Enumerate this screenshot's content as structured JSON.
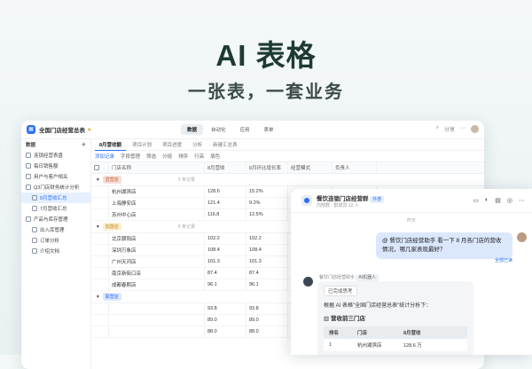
{
  "hero": {
    "title": "AI 表格",
    "subtitle": "一张表，一套业务"
  },
  "app": {
    "title": "全国门店经营总表",
    "modes": [
      "数据",
      "自动化",
      "应用",
      "表单"
    ],
    "share_label": "分享",
    "sidebar": {
      "header": "数据",
      "items": [
        {
          "label": "连锁经营表盘",
          "sub": false
        },
        {
          "label": "每日销售额",
          "sub": false
        },
        {
          "label": "用户与客户相关",
          "sub": false
        },
        {
          "label": "Q3门店财务统计分析",
          "sub": false
        },
        {
          "label": "8月营收汇总",
          "sub": true,
          "active": true
        },
        {
          "label": "7月营收汇总",
          "sub": true
        },
        {
          "label": "产品与库存管理",
          "sub": false
        },
        {
          "label": "出入库管理",
          "sub": true
        },
        {
          "label": "订单分析",
          "sub": true
        },
        {
          "label": "介绍文档",
          "sub": true
        }
      ]
    },
    "tabs": [
      "8月营收额",
      "项目计划",
      "项目进度",
      "分析",
      "新建汇总表"
    ],
    "toolbar": [
      "添加记录",
      "字段管理",
      "筛选",
      "分组",
      "排序",
      "行高",
      "填色"
    ],
    "columns": [
      "门店名称",
      "8月营收",
      "8月环比增长率",
      "经营模式",
      "负责人"
    ],
    "groups": [
      {
        "name": "直营店",
        "color": "#f6e0d8",
        "text": "#c45a3c",
        "count": "3 条记录",
        "rows": [
          [
            "杭州湖滨店",
            "128.6",
            "15.2%"
          ],
          [
            "上海静安店",
            "121.4",
            "9.2%"
          ],
          [
            "苏州中心店",
            "116.8",
            "12.5%"
          ]
        ]
      },
      {
        "name": "加盟店",
        "color": "#fbefcf",
        "text": "#b5831b",
        "count": "6 条记录",
        "rows": [
          [
            "北京朝阳店",
            "102.2",
            "102.2"
          ],
          [
            "深圳万象店",
            "108.4",
            "108.4"
          ],
          [
            "广州天河店",
            "101.3",
            "101.3"
          ],
          [
            "南京新街口店",
            "87.4",
            "87.4"
          ],
          [
            "成都春熙店",
            "96.1",
            "96.1"
          ]
        ]
      },
      {
        "name": "联营店",
        "color": "#dde8fb",
        "text": "#2a6df5",
        "count": "",
        "rows": [
          [
            "",
            "93.8",
            "93.8"
          ],
          [
            "",
            "89.0",
            "89.0"
          ],
          [
            "",
            "88.0",
            "88.0"
          ]
        ]
      }
    ]
  },
  "chat": {
    "title": "餐饮连锁门店经营群",
    "member_tag": "外部",
    "subtitle": "内部群 · 群成员 12 人",
    "timestamp": "昨天",
    "user_message": "@ 餐饮门店经营助手 看一下 8 月各门店的营收情况，哪几家表现最好？",
    "read_label": "全部已读",
    "bot_name": "餐饮门店经营助手",
    "bot_tag": "AI机器人",
    "thinking_label": "已完成思考",
    "reply_intro": "根据 AI 表格\"全国门店经营总表\"统计分析下：",
    "summary_title": "营收前三门店",
    "table_headers": [
      "排名",
      "门店",
      "8月营收"
    ],
    "table_rows": [
      [
        "1",
        "杭州湖滨店",
        "128.6 万"
      ]
    ]
  }
}
